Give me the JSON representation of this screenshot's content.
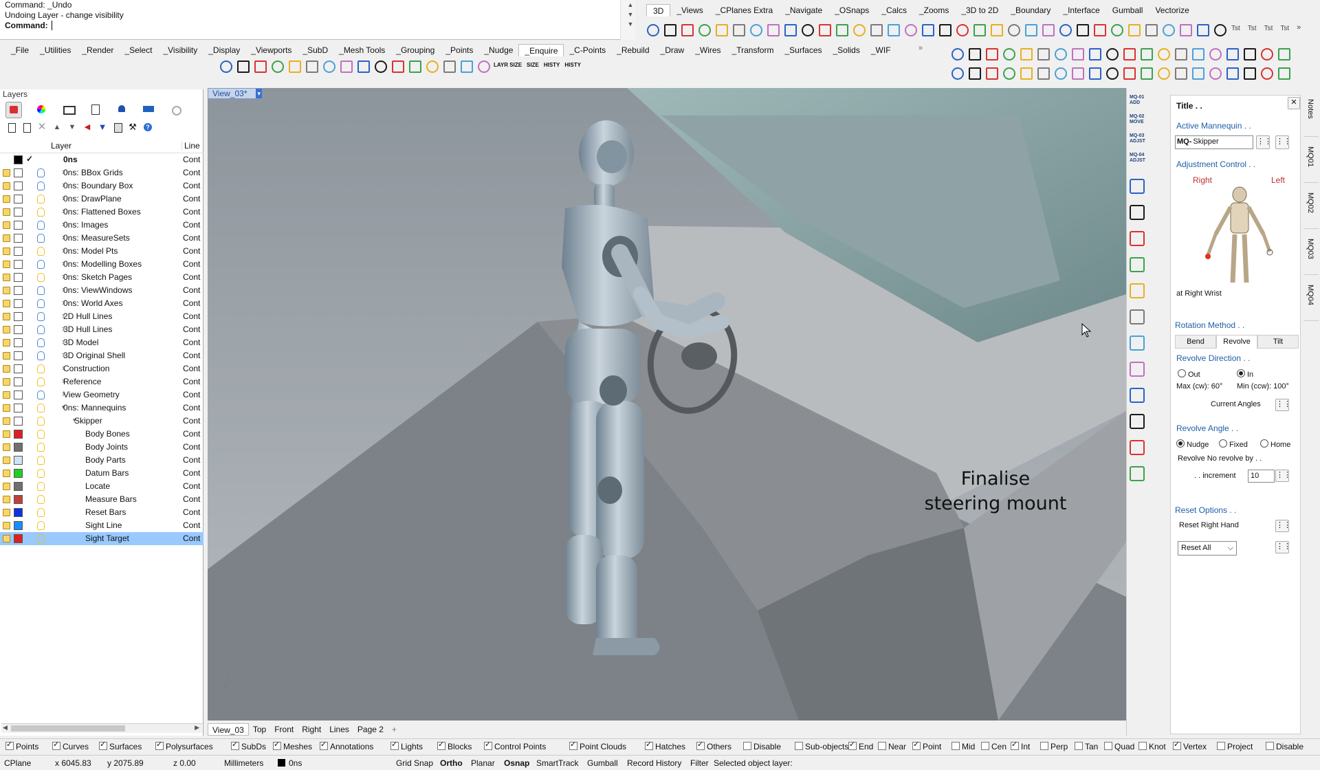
{
  "command": {
    "history": [
      "Command: _Undo",
      "Undoing Layer - change visibility"
    ],
    "prompt": "Command:"
  },
  "tabs_right": [
    "3D",
    "_Views",
    "_CPlanes Extra",
    "_Navigate",
    "_OSnaps",
    "_Calcs",
    "_Zooms",
    "_3D to 2D",
    "_Boundary",
    "_Interface",
    "Gumball",
    "Vectorize"
  ],
  "tabs_right_active": "3D",
  "tst_labels": [
    "Tst",
    "Tst",
    "Tst",
    "Tst"
  ],
  "tabs_left": [
    "_File",
    "_Utilities",
    "_Render",
    "_Select",
    "_Visibility",
    "_Display",
    "_Viewports",
    "_SubD",
    "_Mesh Tools",
    "_Grouping",
    "_Points",
    "_Nudge",
    "_Enquire",
    "_C-Points",
    "_Rebuild",
    "_Draw",
    "_Wires",
    "_Transform",
    "_Surfaces",
    "_Solids",
    "_WIF"
  ],
  "tabs_left_active": "_Enquire",
  "toolbar_text": [
    "LAYR SIZE",
    "SIZE",
    "HISTY",
    "HISTY"
  ],
  "layers": {
    "title": "Layers",
    "col_layer": "Layer",
    "col_line": "Line",
    "rows": [
      {
        "name": "0ns",
        "indent": 0,
        "color": "#000000",
        "line": "Cont",
        "bold": true,
        "current": true
      },
      {
        "name": "0ns: BBox Grids",
        "indent": 1,
        "color": "#ffffff",
        "line": "Cont",
        "exp": ">",
        "bulb": "#4a86d6"
      },
      {
        "name": "0ns: Boundary Box",
        "indent": 1,
        "color": "#ffffff",
        "line": "Cont",
        "exp": ">",
        "bulb": "#4a86d6"
      },
      {
        "name": "0ns: DrawPlane",
        "indent": 1,
        "color": "#ffffff",
        "line": "Cont",
        "exp": ">",
        "bulb": "#f0c020"
      },
      {
        "name": "0ns: Flattened Boxes",
        "indent": 1,
        "color": "#ffffff",
        "line": "Cont",
        "exp": ">",
        "bulb": "#f0c020"
      },
      {
        "name": "0ns: Images",
        "indent": 1,
        "color": "#ffffff",
        "line": "Cont",
        "exp": ">",
        "bulb": "#4a86d6"
      },
      {
        "name": "0ns: MeasureSets",
        "indent": 1,
        "color": "#ffffff",
        "line": "Cont",
        "exp": ">",
        "bulb": "#4a86d6"
      },
      {
        "name": "0ns: Model Pts",
        "indent": 1,
        "color": "#ffffff",
        "line": "Cont",
        "exp": ">",
        "bulb": "#f0c020"
      },
      {
        "name": "0ns: Modelling Boxes",
        "indent": 1,
        "color": "#ffffff",
        "line": "Cont",
        "exp": ">",
        "bulb": "#4a86d6"
      },
      {
        "name": "0ns: Sketch Pages",
        "indent": 1,
        "color": "#ffffff",
        "line": "Cont",
        "exp": ">",
        "bulb": "#f0c020"
      },
      {
        "name": "0ns: ViewWindows",
        "indent": 1,
        "color": "#ffffff",
        "line": "Cont",
        "exp": ">",
        "bulb": "#4a86d6"
      },
      {
        "name": "0ns: World Axes",
        "indent": 1,
        "color": "#ffffff",
        "line": "Cont",
        "exp": ">",
        "bulb": "#4a86d6"
      },
      {
        "name": "2D Hull Lines",
        "indent": 1,
        "color": "#ffffff",
        "line": "Cont",
        "exp": ">",
        "bulb": "#4a86d6"
      },
      {
        "name": "3D Hull Lines",
        "indent": 1,
        "color": "#ffffff",
        "line": "Cont",
        "exp": ">",
        "bulb": "#4a86d6"
      },
      {
        "name": "3D Model",
        "indent": 1,
        "color": "#ffffff",
        "line": "Cont",
        "exp": ">",
        "bulb": "#4a86d6"
      },
      {
        "name": "3D Original Shell",
        "indent": 1,
        "color": "#ffffff",
        "line": "Cont",
        "exp": ">",
        "bulb": "#4a86d6"
      },
      {
        "name": "Construction",
        "indent": 1,
        "color": "#ffffff",
        "line": "Cont",
        "exp": ">",
        "bulb": "#f0c020"
      },
      {
        "name": "Reference",
        "indent": 1,
        "color": "#ffffff",
        "line": "Cont",
        "exp": ">",
        "bulb": "#f0c020"
      },
      {
        "name": "View Geometry",
        "indent": 1,
        "color": "#ffffff",
        "line": "Cont",
        "exp": ">",
        "bulb": "#4a86d6"
      },
      {
        "name": "0ns: Mannequins",
        "indent": 1,
        "color": "#ffffff",
        "line": "Cont",
        "exp": "v",
        "bulb": "#f0c020"
      },
      {
        "name": "Skipper",
        "indent": 2,
        "color": "#ffffff",
        "line": "Cont",
        "exp": "v",
        "bulb": "#f0c020"
      },
      {
        "name": "Body Bones",
        "indent": 3,
        "color": "#e02020",
        "line": "Cont",
        "bulb": "#f0c020"
      },
      {
        "name": "Body Joints",
        "indent": 3,
        "color": "#707070",
        "line": "Cont",
        "bulb": "#f0c020"
      },
      {
        "name": "Body Parts",
        "indent": 3,
        "color": "#cfe3f5",
        "line": "Cont",
        "bulb": "#f0c020"
      },
      {
        "name": "Datum Bars",
        "indent": 3,
        "color": "#20d020",
        "line": "Cont",
        "bulb": "#f0c020"
      },
      {
        "name": "Locate",
        "indent": 3,
        "color": "#707070",
        "line": "Cont",
        "bulb": "#f0c020"
      },
      {
        "name": "Measure Bars",
        "indent": 3,
        "color": "#c04040",
        "line": "Cont",
        "bulb": "#f0c020"
      },
      {
        "name": "Reset Bars",
        "indent": 3,
        "color": "#1030e0",
        "line": "Cont",
        "bulb": "#f0c020"
      },
      {
        "name": "Sight Line",
        "indent": 3,
        "color": "#1a8cff",
        "line": "Cont",
        "bulb": "#f0c020"
      },
      {
        "name": "Sight Target",
        "indent": 3,
        "color": "#e02020",
        "line": "Cont",
        "bulb": "#f0c020",
        "selected": true
      }
    ]
  },
  "viewport": {
    "name": "View_03*",
    "annotation_line1": "Finalise",
    "annotation_line2": "steering mount",
    "axis_z": "z",
    "axis_y": "y",
    "axis_x": "x",
    "tabs": [
      "View_03",
      "Top",
      "Front",
      "Right",
      "Lines",
      "Page 2"
    ]
  },
  "macro_buttons": [
    "MQ-01 ADD",
    "MQ-02 MOVE",
    "MQ-03 ADJST",
    "MQ-04 ADJST"
  ],
  "panel": {
    "title": "Title . .",
    "active_mannequin": "Active Mannequin . .",
    "mq_prefix": "MQ-",
    "mq_name": "Skipper",
    "adjustment_control": "Adjustment Control . .",
    "right": "Right",
    "left": "Left",
    "at_label": "at Right Wrist",
    "rotation_method": "Rotation Method . .",
    "rot_tabs": [
      "Bend",
      "Revolve",
      "Tilt"
    ],
    "rot_active": "Revolve",
    "revolve_direction": "Revolve Direction . .",
    "out": "Out",
    "in": "In",
    "max_cw": "Max (cw): 60°",
    "min_ccw": "Min (ccw): 100°",
    "current_angles": "Current Angles",
    "revolve_angle": "Revolve Angle . .",
    "nudge": "Nudge",
    "fixed": "Fixed",
    "home": "Home",
    "revolve_note": "Revolve No revolve by . .",
    "increment_label": ". . increment",
    "increment_value": "10",
    "reset_options": "Reset Options . .",
    "reset_right_hand": "Reset Right Hand",
    "reset_all": "Reset All"
  },
  "side_tabs": [
    "Notes",
    "MQ01",
    "MQ02",
    "MQ03",
    "MQ04"
  ],
  "filters": {
    "left": [
      {
        "label": "Points",
        "on": true
      },
      {
        "label": "Curves",
        "on": true
      },
      {
        "label": "Surfaces",
        "on": true
      },
      {
        "label": "Polysurfaces",
        "on": true
      },
      {
        "label": "SubDs",
        "on": true
      },
      {
        "label": "Meshes",
        "on": true
      },
      {
        "label": "Annotations",
        "on": true
      },
      {
        "label": "Lights",
        "on": true
      },
      {
        "label": "Blocks",
        "on": true
      },
      {
        "label": "Control Points",
        "on": true
      },
      {
        "label": "Point Clouds",
        "on": true
      },
      {
        "label": "Hatches",
        "on": true
      },
      {
        "label": "Others",
        "on": true
      },
      {
        "label": "Disable",
        "on": false
      },
      {
        "label": "Sub-objects",
        "on": false
      }
    ],
    "right": [
      {
        "label": "End",
        "on": true
      },
      {
        "label": "Near",
        "on": false
      },
      {
        "label": "Point",
        "on": true
      },
      {
        "label": "Mid",
        "on": false
      },
      {
        "label": "Cen",
        "on": false
      },
      {
        "label": "Int",
        "on": true
      },
      {
        "label": "Perp",
        "on": false
      },
      {
        "label": "Tan",
        "on": false
      },
      {
        "label": "Quad",
        "on": false
      },
      {
        "label": "Knot",
        "on": false
      },
      {
        "label": "Vertex",
        "on": true
      },
      {
        "label": "Project",
        "on": false
      },
      {
        "label": "Disable",
        "on": false
      }
    ]
  },
  "status": {
    "cplane": "CPlane",
    "x": "x 6045.83",
    "y": "y 2075.89",
    "z": "z 0.00",
    "units": "Millimeters",
    "layer": "0ns",
    "grid_snap": "Grid Snap",
    "ortho": "Ortho",
    "planar": "Planar",
    "osnap": "Osnap",
    "smarttrack": "SmartTrack",
    "gumball": "Gumball",
    "record_history": "Record History",
    "filter": "Filter",
    "message": "Selected object layer:"
  }
}
